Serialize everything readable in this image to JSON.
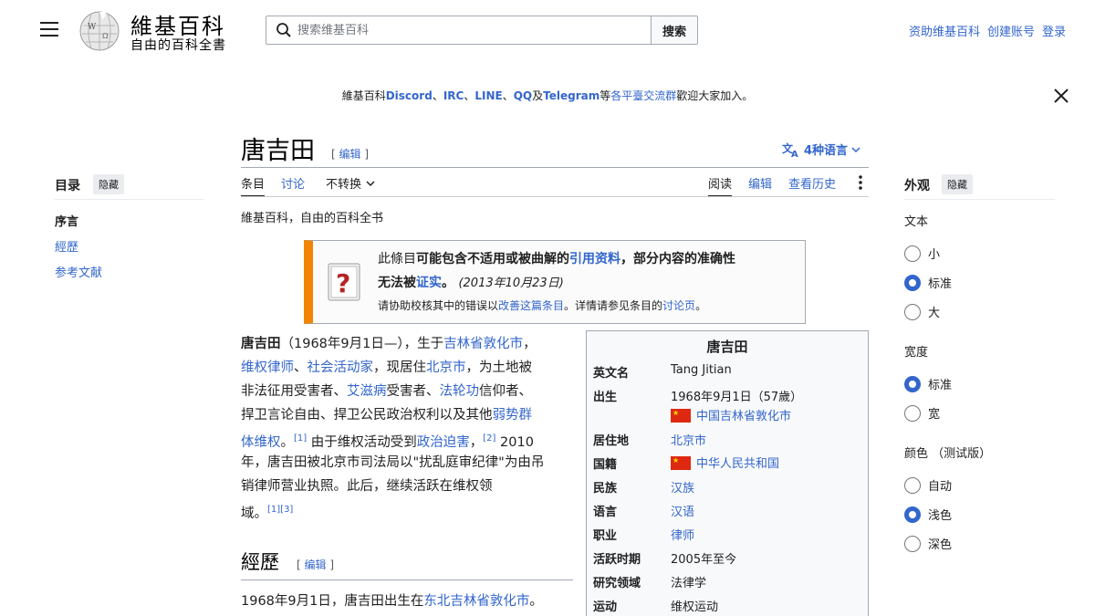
{
  "header": {
    "logo_title": "維基百科",
    "logo_subtitle": "自由的百科全書",
    "search_placeholder": "搜索维基百科",
    "search_button": "搜索",
    "user_links": [
      "资助维基百科",
      "创建账号",
      "登录"
    ]
  },
  "banner": {
    "prefix": "維基百科",
    "discord": "Discord",
    "sep1": "、",
    "irc": "IRC",
    "sep2": "、",
    "line": "LINE",
    "sep3": "、",
    "qq": "QQ",
    "and": "及",
    "telegram": "Telegram",
    "deng": "等",
    "link": "各平臺交流群",
    "suffix": "歡迎大家加入。"
  },
  "toc": {
    "title": "目录",
    "hide": "隐藏",
    "items": [
      "序言",
      "經歷",
      "参考文献"
    ]
  },
  "article": {
    "title": "唐吉田",
    "edit": "编辑",
    "languages": "4种语言",
    "tabs": {
      "article": "条目",
      "talk": "讨论",
      "variant": "不转换",
      "read": "阅读",
      "edit": "编辑",
      "history": "查看历史"
    },
    "from_wiki": "維基百科，自由的百科全书",
    "ambox": {
      "l1_a": "此條目",
      "l1_b": "可能包含不适用或被曲解的",
      "l1_link": "引用资料",
      "l1_c": "，部分内容的准确性",
      "l2_a": "无法被",
      "l2_link": "证实",
      "l2_b": "。",
      "l2_date": "(2013年10月23日)",
      "l3_a": "请协助校核其中的错误以",
      "l3_link1": "改善这篇条目",
      "l3_b": "。详情请参见条目的",
      "l3_link2": "讨论页",
      "l3_c": "。"
    },
    "para": {
      "name": "唐吉田",
      "p1": "（1968年9月1日—），生于",
      "p1_link": "吉林省敦化市",
      "p1_end": "，",
      "l2_link1": "维权律师",
      "l2_sep": "、",
      "l2_link2": "社会活动家",
      "l2_mid": "，现居住",
      "l2_link3": "北京市",
      "l2_end": "，为土地被",
      "l3_a": "非法征用受害者、",
      "l3_link1": "艾滋病",
      "l3_b": "受害者、",
      "l3_link2": "法轮功",
      "l3_c": "信仰者、",
      "l4_a": "捍卫言论自由、捍卫公民政治权利以及其他",
      "l4_link": "弱势群",
      "l5_link": "体维权",
      "l5_a": "。",
      "l5_ref1": "[1]",
      "l5_b": " 由于维权活动受到",
      "l5_link2": "政治迫害",
      "l5_c": "，",
      "l5_ref2": "[2]",
      "l5_d": " 2010",
      "l6": "年，唐吉田被北京市司法局以\"扰乱庭审纪律\"为由吊",
      "l7": "销律师营业执照。此后，继续活跃在维权领",
      "l8": "域。",
      "l8_ref": "[1][3]"
    },
    "section": {
      "title": "經歷",
      "edit": "编辑",
      "text_a": "1968年9月1日，唐吉田出生在",
      "text_link": "东北吉林省敦化市",
      "text_b": "。"
    }
  },
  "infobox": {
    "title": "唐吉田",
    "rows": [
      {
        "label": "英文名",
        "value": "Tang Jitian"
      },
      {
        "label": "出生",
        "value": "1968年9月1日（57歲）",
        "value2": "中国吉林省敦化市"
      },
      {
        "label": "居住地",
        "value": "北京市"
      },
      {
        "label": "国籍",
        "value": "中华人民共和国"
      },
      {
        "label": "民族",
        "value": "汉族"
      },
      {
        "label": "语言",
        "value": "汉语"
      },
      {
        "label": "职业",
        "value": "律师"
      },
      {
        "label": "活跃时期",
        "value": "2005年至今"
      },
      {
        "label": "研究领域",
        "value": "法律学"
      },
      {
        "label": "运动",
        "value": "维权运动"
      }
    ]
  },
  "appearance": {
    "title": "外观",
    "hide": "隐藏",
    "text_label": "文本",
    "text_options": [
      "小",
      "标准",
      "大"
    ],
    "width_label": "宽度",
    "width_options": [
      "标准",
      "宽"
    ],
    "color_label": "颜色 （测试版）",
    "color_options": [
      "自动",
      "浅色",
      "深色"
    ]
  }
}
